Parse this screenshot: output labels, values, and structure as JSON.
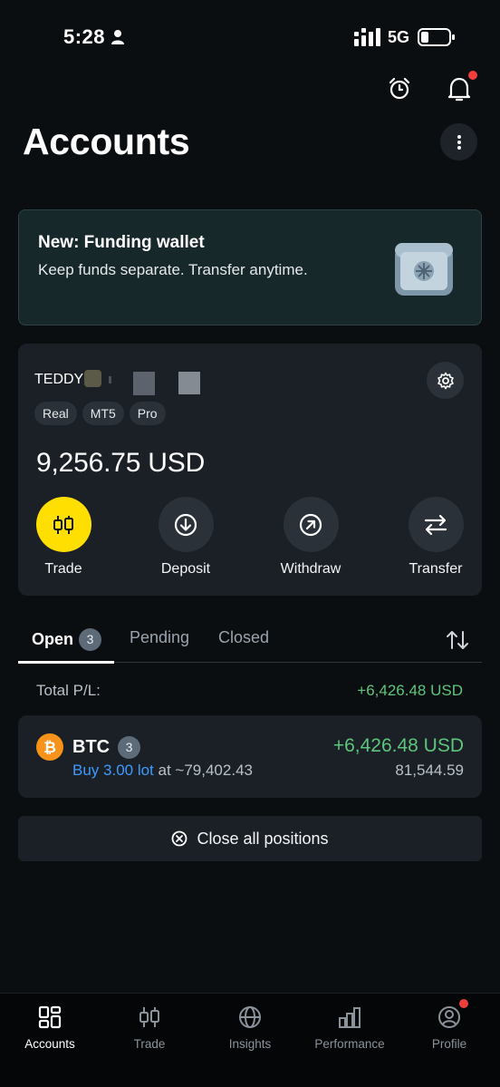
{
  "status_bar": {
    "time": "5:28",
    "network": "5G"
  },
  "header": {
    "title": "Accounts"
  },
  "promo": {
    "title": "New: Funding wallet",
    "subtitle": "Keep funds separate. Transfer anytime."
  },
  "account": {
    "name": "TEDDY",
    "tags": [
      "Real",
      "MT5",
      "Pro"
    ],
    "balance": "9,256.75 USD",
    "actions": [
      "Trade",
      "Deposit",
      "Withdraw",
      "Transfer"
    ]
  },
  "tabs": {
    "open": "Open",
    "open_count": "3",
    "pending": "Pending",
    "closed": "Closed"
  },
  "summary": {
    "label": "Total P/L:",
    "value": "+6,426.48 USD"
  },
  "position": {
    "symbol": "BTC",
    "count": "3",
    "side_lot": "Buy 3.00 lot",
    "at_price": "at ~79,402.43",
    "pl": "+6,426.48 USD",
    "current_price": "81,544.59"
  },
  "close_all_label": "Close all positions",
  "bottom_nav": [
    "Accounts",
    "Trade",
    "Insights",
    "Performance",
    "Profile"
  ],
  "colors": {
    "accent_yellow": "#ffde02",
    "profit_green": "#5ec57c",
    "buy_blue": "#3d9bff",
    "alert_red": "#f23d3d",
    "btc_orange": "#f7931a"
  }
}
